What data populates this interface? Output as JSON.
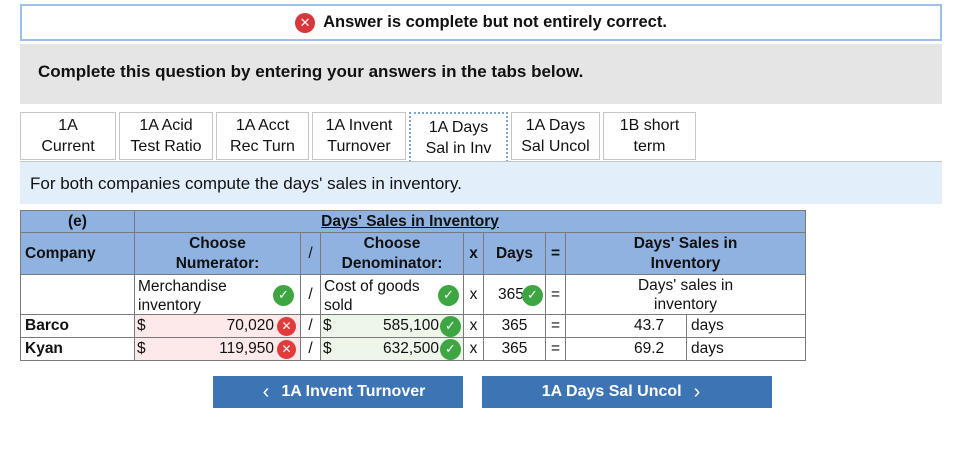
{
  "banner": {
    "message": "Answer is complete but not entirely correct."
  },
  "instruction": "Complete this question by entering your answers in the tabs below.",
  "tabs": [
    {
      "line1": "1A",
      "line2": "Current"
    },
    {
      "line1": "1A Acid",
      "line2": "Test Ratio"
    },
    {
      "line1": "1A Acct",
      "line2": "Rec Turn"
    },
    {
      "line1": "1A Invent",
      "line2": "Turnover"
    },
    {
      "line1": "1A Days",
      "line2": "Sal in Inv"
    },
    {
      "line1": "1A Days",
      "line2": "Sal Uncol"
    },
    {
      "line1": "1B short",
      "line2": "term"
    }
  ],
  "tab_prompt": "For both companies compute the days' sales in inventory.",
  "table": {
    "label_e": "(e)",
    "title": "Days' Sales in Inventory",
    "company_header": "Company",
    "numerator_header": "Choose Numerator:",
    "slash": "/",
    "denominator_header": "Choose Denominator:",
    "times": "x",
    "days_header": "Days",
    "equals": "=",
    "result_header": "Days' Sales in Inventory",
    "numerator_choice": "Merchandise inventory",
    "denominator_choice": "Cost of goods sold",
    "days_value": "365",
    "result_label": "Days' sales in inventory",
    "rows": [
      {
        "company": "Barco",
        "cur": "$",
        "numerator": "70,020",
        "cur2": "$",
        "denominator": "585,100",
        "days": "365",
        "result": "43.7",
        "unit": "days"
      },
      {
        "company": "Kyan",
        "cur": "$",
        "numerator": "119,950",
        "cur2": "$",
        "denominator": "632,500",
        "days": "365",
        "result": "69.2",
        "unit": "days"
      }
    ]
  },
  "nav": {
    "prev_label": "1A Invent Turnover",
    "next_label": "1A Days Sal Uncol"
  },
  "colors": {
    "header_blue": "#8fb2e0",
    "correct_green": "#3ea543",
    "incorrect_red": "#e23b3b",
    "nav_blue": "#3d74b4"
  }
}
